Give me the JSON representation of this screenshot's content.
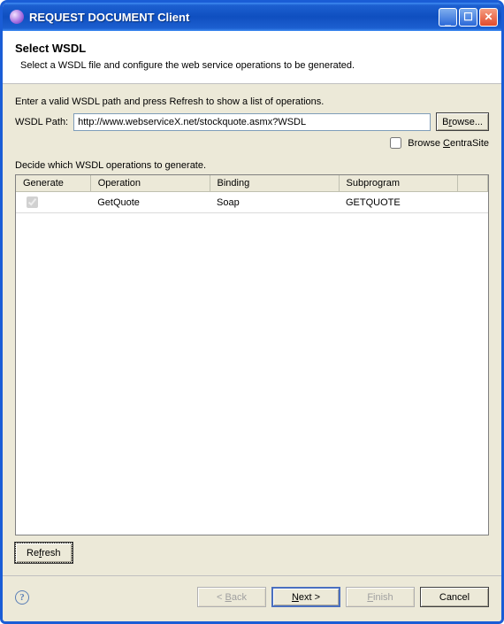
{
  "window": {
    "title": "REQUEST DOCUMENT Client"
  },
  "header": {
    "title": "Select WSDL",
    "description": "Select a WSDL file and configure the web service operations to be generated."
  },
  "form": {
    "instruction": "Enter a valid WSDL path and press Refresh to show a list of operations.",
    "path_label": "WSDL Path:",
    "path_value": "http://www.webserviceX.net/stockquote.asmx?WSDL",
    "browse_label_pre": "B",
    "browse_label_mn": "r",
    "browse_label_post": "owse...",
    "centrasite_pre": "Browse ",
    "centrasite_mn": "C",
    "centrasite_post": "entraSite",
    "decide_label": "Decide which WSDL operations to generate.",
    "refresh_pre": "Re",
    "refresh_mn": "f",
    "refresh_post": "resh"
  },
  "table": {
    "headers": {
      "generate": "Generate",
      "operation": "Operation",
      "binding": "Binding",
      "subprogram": "Subprogram"
    },
    "rows": [
      {
        "generate": true,
        "operation": "GetQuote",
        "binding": "Soap",
        "subprogram": "GETQUOTE"
      }
    ]
  },
  "footer": {
    "back_pre": "< ",
    "back_mn": "B",
    "back_post": "ack",
    "next_pre": "",
    "next_mn": "N",
    "next_post": "ext >",
    "finish_pre": "",
    "finish_mn": "F",
    "finish_post": "inish",
    "cancel": "Cancel"
  }
}
